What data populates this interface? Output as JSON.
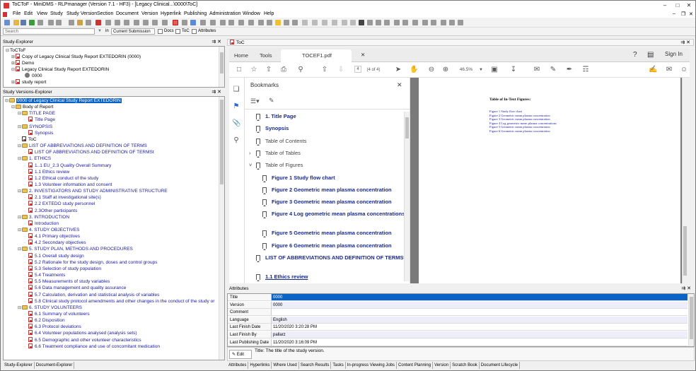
{
  "window": {
    "title": "ToCToF - MiniDMS - RLPmanager (Version 7.1 - HF3) - [Legacy Clinical...\\0000\\ToC]",
    "pdf_window_label": "ToC"
  },
  "menu": [
    "File",
    "Edit",
    "View",
    "Study",
    "Study Version",
    "Section",
    "Document",
    "Version",
    "Hyperlink",
    "Publishing",
    "Administration",
    "Window",
    "Help"
  ],
  "searchbar": {
    "placeholder": "Search",
    "in_label": "in",
    "scope": "Current Submission",
    "checks": [
      "Docs",
      "ToC",
      "Attributes"
    ]
  },
  "study_explorer": {
    "title": "Study-Explorer",
    "items": [
      "ToCToF",
      "Copy of Legacy Clinical Study Report EXTEDORIN (0000)",
      "Demo",
      "Legacy Clinical Study Report EXTEDORIN",
      "0000",
      "study report"
    ]
  },
  "versions_explorer": {
    "title": "Study Versions-Explorer",
    "rows": [
      {
        "t": "0000 of Legacy Clinical Study Report EXTEDORIN",
        "lvl": 0,
        "k": "sel"
      },
      {
        "t": "Body of Report",
        "lvl": 1,
        "k": "folder"
      },
      {
        "t": "TITLE PAGE",
        "lvl": 2,
        "k": "folder"
      },
      {
        "t": "Title Page",
        "lvl": 3,
        "k": "doc"
      },
      {
        "t": "SYNOPSIS",
        "lvl": 2,
        "k": "folder"
      },
      {
        "t": "Synopsis",
        "lvl": 3,
        "k": "doc"
      },
      {
        "t": "ToC",
        "lvl": 2,
        "k": "toc"
      },
      {
        "t": "LIST OF ABBREVIATIONS AND DEFINITION OF TERMS",
        "lvl": 2,
        "k": "folder"
      },
      {
        "t": "LIST OF ABBREVIATIONS AND DEFINITION OF TERMSt",
        "lvl": 3,
        "k": "doc"
      },
      {
        "t": "1. ETHICS",
        "lvl": 2,
        "k": "folder"
      },
      {
        "t": "1..1 EU_2.3 Quality Overall Summary",
        "lvl": 3,
        "k": "doc"
      },
      {
        "t": "1.1 Ethics review",
        "lvl": 3,
        "k": "doc"
      },
      {
        "t": "1.2 Ethical conduct of the study",
        "lvl": 3,
        "k": "doc"
      },
      {
        "t": "1.3 Volunteer information and consent",
        "lvl": 3,
        "k": "doc"
      },
      {
        "t": "2. INVESTIGATORS AND STUDY ADMINISTRATIVE STRUCTURE",
        "lvl": 2,
        "k": "folder"
      },
      {
        "t": "2.1 Staff at investigational site(s)",
        "lvl": 3,
        "k": "doc"
      },
      {
        "t": "2.2 EXTEDO study personnel",
        "lvl": 3,
        "k": "doc"
      },
      {
        "t": "2.3Other participants",
        "lvl": 3,
        "k": "doc"
      },
      {
        "t": "3. INTRODUCTION",
        "lvl": 2,
        "k": "folder"
      },
      {
        "t": "Introduction",
        "lvl": 3,
        "k": "doc"
      },
      {
        "t": "4. STUDY OBJECTIVES",
        "lvl": 2,
        "k": "folder"
      },
      {
        "t": "4.1 Primary objectives",
        "lvl": 3,
        "k": "doc"
      },
      {
        "t": "4.2 Secondary objectives",
        "lvl": 3,
        "k": "doc"
      },
      {
        "t": "5. STUDY PLAN, METHODS AND PROCEDURES",
        "lvl": 2,
        "k": "folder"
      },
      {
        "t": "5.1 Overall study design",
        "lvl": 3,
        "k": "doc"
      },
      {
        "t": "5.2 Rationale for the study design, doses and control groups",
        "lvl": 3,
        "k": "doc"
      },
      {
        "t": "5.3 Selection of study population",
        "lvl": 3,
        "k": "doc"
      },
      {
        "t": "5.4 Treatments",
        "lvl": 3,
        "k": "doc"
      },
      {
        "t": "5.5 Measurements of study variables",
        "lvl": 3,
        "k": "doc"
      },
      {
        "t": "5.6 Data management and quality assurance",
        "lvl": 3,
        "k": "doc"
      },
      {
        "t": "5.7 Calculation, derivation and statistical analysis of variables",
        "lvl": 3,
        "k": "doc"
      },
      {
        "t": "5.8 Clinical study protocol amendments and other changes in the conduct of the study or",
        "lvl": 3,
        "k": "doc"
      },
      {
        "t": "6. STUDY VOLUNTEERS",
        "lvl": 2,
        "k": "folder"
      },
      {
        "t": "6.1 Summary of volunteers",
        "lvl": 3,
        "k": "doc"
      },
      {
        "t": "6.2 Disposition",
        "lvl": 3,
        "k": "doc"
      },
      {
        "t": "6.3 Protocol deviations",
        "lvl": 3,
        "k": "doc"
      },
      {
        "t": "6.4 Volunteer populations analysed (analysis sets)",
        "lvl": 3,
        "k": "doc"
      },
      {
        "t": "6.5 Demographic and other volunteer characteristics",
        "lvl": 3,
        "k": "doc"
      },
      {
        "t": "6.6 Treatment compliance and use of concomitant medication",
        "lvl": 3,
        "k": "doc"
      }
    ]
  },
  "left_tabs": [
    "Study-Explorer",
    "Document-Explorer"
  ],
  "pdf": {
    "tabs": {
      "home": "Home",
      "tools": "Tools",
      "file": "TOCEF1.pdf"
    },
    "sign_in": "Sign In",
    "page_current": "4",
    "page_total": "(4 of 4)",
    "zoom": "46.5%",
    "bookmarks_title": "Bookmarks",
    "bookmarks": [
      {
        "t": "1. Title Page",
        "lvl": 0,
        "s": "bold"
      },
      {
        "t": "Synopsis",
        "lvl": 0,
        "s": "bold"
      },
      {
        "t": "Table of Contents",
        "lvl": 0,
        "s": "gray"
      },
      {
        "t": "Table of Tables",
        "lvl": 0,
        "s": "gray",
        "exp": ">"
      },
      {
        "t": "Table of Figures",
        "lvl": 0,
        "s": "gray",
        "exp": "v"
      },
      {
        "t": "Figure 1 Study flow chart",
        "lvl": 1,
        "s": "bold"
      },
      {
        "t": "Figure 2 Geometric mean plasma concentration",
        "lvl": 1,
        "s": "bold"
      },
      {
        "t": "Figure 3 Geometric mean plasma concentration",
        "lvl": 1,
        "s": "bold"
      },
      {
        "t": "Figure 4 Log geometric mean plasma concentrations",
        "lvl": 1,
        "s": "bold",
        "two": true
      },
      {
        "t": "Figure 5 Geometric mean plasma concentration",
        "lvl": 1,
        "s": "bold"
      },
      {
        "t": "Figure 6 Geometric mean plasma concentration",
        "lvl": 1,
        "s": "bold"
      },
      {
        "t": "LIST OF ABBREVIATIONS AND DEFINITION OF TERMSt",
        "lvl": 0,
        "s": "bold",
        "two": true
      },
      {
        "t": "1.1 Ethics review",
        "lvl": 0,
        "s": "bold",
        "u": true
      },
      {
        "t": "",
        "lvl": 0,
        "s": "bold"
      }
    ],
    "page_title": "Table of In-Text Figures:",
    "page_lines": [
      "Figure 1 Study flow chart",
      "Figure 2 Geometric mean plasma concentration",
      "Figure 3 Geometric mean plasma concentration",
      "Figure 4 Log geometric mean plasma concentrations",
      "Figure 5 Geometric mean plasma concentration",
      "Figure 6 Geometric mean plasma concentration"
    ]
  },
  "attributes": {
    "title": "Attributes",
    "rows": [
      {
        "k": "Title",
        "v": "0000",
        "sel": true
      },
      {
        "k": "Version",
        "v": "0000"
      },
      {
        "k": "Comment",
        "v": ""
      },
      {
        "k": "Language",
        "v": "English"
      },
      {
        "k": "Last Finish Date",
        "v": "11/20/2020 3:20:28 PM"
      },
      {
        "k": "Last Finish By",
        "v": "pallarz"
      },
      {
        "k": "Last Publishing Date",
        "v": "11/20/2020 3:16:09 PM"
      }
    ],
    "edit_label": "Edit",
    "hint": "Title: The title of the study version."
  },
  "right_tabs": [
    "Attributes",
    "Hyperlinks",
    "Where Used",
    "Search Results",
    "Tasks",
    "In-progress Viewing Jobs",
    "Content Planning",
    "Version",
    "Scratch Book",
    "Document Lifecycle"
  ],
  "colors": {
    "accent": "#0a64c8",
    "navy": "#1a1aa0",
    "folder": "#e8c35a"
  }
}
